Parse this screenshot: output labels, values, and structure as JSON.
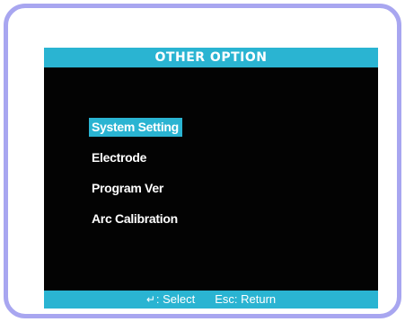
{
  "screen": {
    "title": "OTHER OPTION",
    "menu": [
      {
        "label": "System Setting",
        "selected": true
      },
      {
        "label": "Electrode",
        "selected": false
      },
      {
        "label": "Program Ver",
        "selected": false
      },
      {
        "label": "Arc Calibration",
        "selected": false
      }
    ],
    "status": {
      "select_icon": "↵",
      "select_label": ": Select",
      "return_label": "Esc: Return"
    }
  },
  "colors": {
    "accent": "#2ab4d2",
    "screen_bg": "#030303",
    "bezel": "#a8a6f0",
    "text": "#ffffff"
  },
  "icons": {
    "select": "enter-key-icon"
  }
}
